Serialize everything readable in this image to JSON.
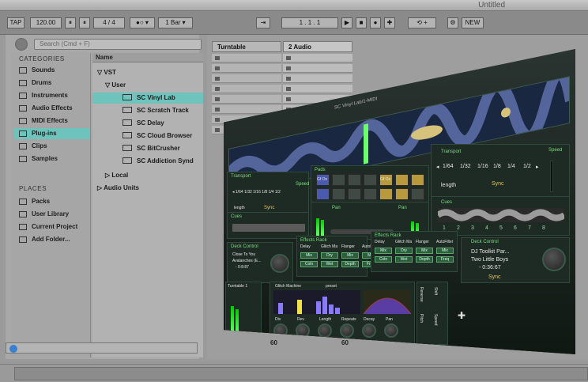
{
  "window": {
    "title": "Untitled"
  },
  "transport": {
    "tap": "TAP",
    "tempo": "120.00",
    "time_sig_num": "4",
    "time_sig_den": "4",
    "slash": "/",
    "quantize": "1 Bar",
    "position": "1 .  1 .  1",
    "new_label": "NEW"
  },
  "browser": {
    "search_placeholder": "Search (Cmd + F)",
    "categories_heading": "CATEGORIES",
    "categories": [
      "Sounds",
      "Drums",
      "Instruments",
      "Audio Effects",
      "MIDI Effects",
      "Plug-ins",
      "Clips",
      "Samples"
    ],
    "selected_category": "Plug-ins",
    "places_heading": "PLACES",
    "places": [
      "Packs",
      "User Library",
      "Current Project",
      "Add Folder..."
    ],
    "name_header": "Name",
    "tree": {
      "vst": "VST",
      "user": "User",
      "plugins": [
        "SC Vinyl Lab",
        "SC Scratch Track",
        "SC Delay",
        "SC Cloud Browser",
        "SC BitCrusher",
        "SC Addiction Synd"
      ],
      "selected_plugin": "SC Vinyl Lab",
      "local": "Local",
      "audio_units": "Audio Units"
    }
  },
  "session": {
    "tracks": [
      "Turntable",
      "2 Audio"
    ],
    "clip_slot_count": 8,
    "scene_numbers": [
      "60",
      "60"
    ]
  },
  "plugin": {
    "window_title": "SC Vinyl Lab/1-MIDI",
    "transport_label": "Transport",
    "speed_label": "Speed",
    "rates": [
      "1/64",
      "1/32",
      "1/16",
      "1/8",
      "1/4",
      "1/2"
    ],
    "length_label": "length",
    "sync_label": "Sync",
    "cues_label": "Cues",
    "cue_numbers": [
      "1",
      "2",
      "3",
      "4",
      "5",
      "6",
      "7",
      "8"
    ],
    "pads_label": "Pads",
    "pad_labels": [
      "Gf Os",
      "Gf Os"
    ],
    "pan_label": "Pan",
    "effects_rack": "Effects Rack",
    "effects": [
      "Delay",
      "Glitch Ma",
      "Flanger",
      "AutoFilter"
    ],
    "fx_params": [
      "Mix",
      "Dry",
      "Mix",
      "Mix"
    ],
    "fx_params2": [
      "Coln",
      "Wet",
      "Depth",
      "Freq"
    ],
    "deck_control": "Deck Control",
    "deck_track_title": "DJ Toolkit Par...",
    "deck_track_artist": "Two Little Boys",
    "deck_time": "- 0:36:67",
    "deck_small_title": "Close To You",
    "deck_small_artist": "Avalanches (E...",
    "deck_small_time": "- 0:8:87",
    "turntable_label": "Turntable 1",
    "glitch_title": "Glitch Machine",
    "glitch_preset": "preset",
    "glitch_knobs": [
      "Div",
      "Rev",
      "Length",
      "Repeats",
      "Decay",
      "Pan"
    ],
    "side_labels": [
      "Reverse",
      "Shift",
      "Pitch",
      "Speed"
    ]
  }
}
